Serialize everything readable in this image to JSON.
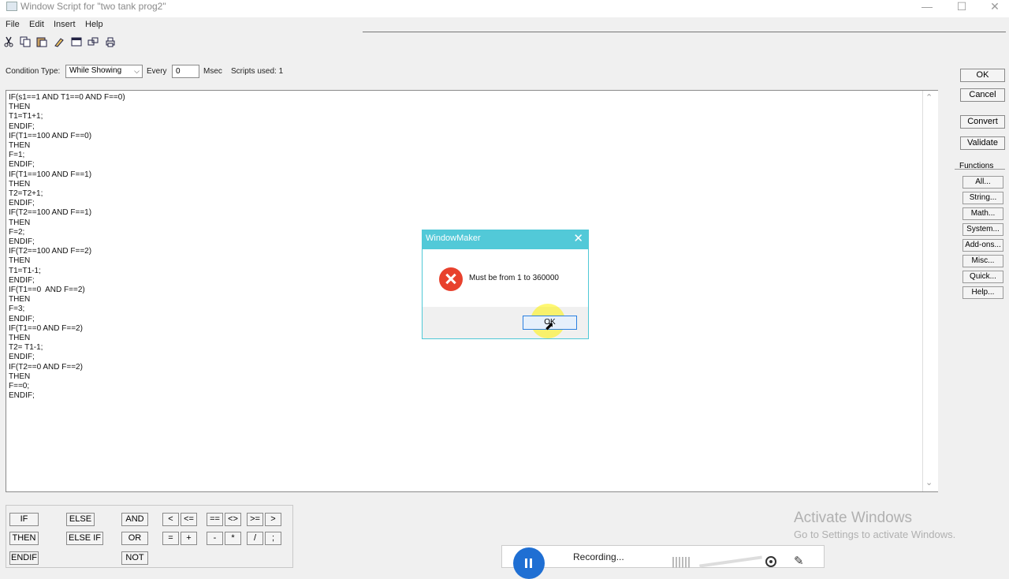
{
  "window": {
    "title": "Window Script for \"two tank prog2\"",
    "minimize": "—",
    "maximize": "☐",
    "close": "✕"
  },
  "menu": [
    "File",
    "Edit",
    "Insert",
    "Help"
  ],
  "toolbar": [
    "cut-icon",
    "copy-icon",
    "paste-icon",
    "find-icon",
    "window-icon",
    "link-icon",
    "print-icon"
  ],
  "condition": {
    "label": "Condition Type:",
    "value": "While Showing",
    "every_label": "Every",
    "every_value": "0",
    "msec_label": "Msec",
    "scripts_used": "Scripts used: 1"
  },
  "code": [
    "IF(s1==1 AND T1==0 AND F==0)",
    "THEN",
    "T1=T1+1;",
    "ENDIF;",
    "IF(T1==100 AND F==0)",
    "THEN",
    "F=1;",
    "ENDIF;",
    "IF(T1==100 AND F==1)",
    "THEN",
    "T2=T2+1;",
    "ENDIF;",
    "IF(T2==100 AND F==1)",
    "THEN",
    "F=2;",
    "ENDIF;",
    "IF(T2==100 AND F==2)",
    "THEN",
    "T1=T1-1;",
    "ENDIF;",
    "IF(T1==0  AND F==2)",
    "THEN",
    "F=3;",
    "ENDIF;",
    "IF(T1==0 AND F==2)",
    "THEN",
    "T2= T1-1;",
    "ENDIF;",
    "IF(T2==0 AND F==2)",
    "THEN",
    "F==0;",
    "ENDIF;"
  ],
  "buttons": {
    "ok": "OK",
    "cancel": "Cancel",
    "convert": "Convert",
    "validate": "Validate"
  },
  "functions": {
    "label": "Functions",
    "items": [
      "All...",
      "String...",
      "Math...",
      "System...",
      "Add-ons...",
      "Misc...",
      "Quick...",
      "Help..."
    ]
  },
  "operators": {
    "if": "IF",
    "then": "THEN",
    "endif": "ENDIF",
    "else": "ELSE",
    "elseif": "ELSE IF",
    "and": "AND",
    "or": "OR",
    "not": "NOT",
    "lt": "<",
    "le": "<=",
    "eq": "==",
    "ne": "<>",
    "ge": ">=",
    "gt": ">",
    "assign": "=",
    "plus": "+",
    "minus": "-",
    "times": "*",
    "divide": "/",
    "semicolon": ";"
  },
  "dialog": {
    "title": "WindowMaker",
    "message": "Must be from 1 to 360000",
    "ok": "OK",
    "close": "✕"
  },
  "watermark": {
    "line1": "Activate Windows",
    "line2": "Go to Settings to activate Windows."
  },
  "recorder": {
    "status": "Recording..."
  }
}
